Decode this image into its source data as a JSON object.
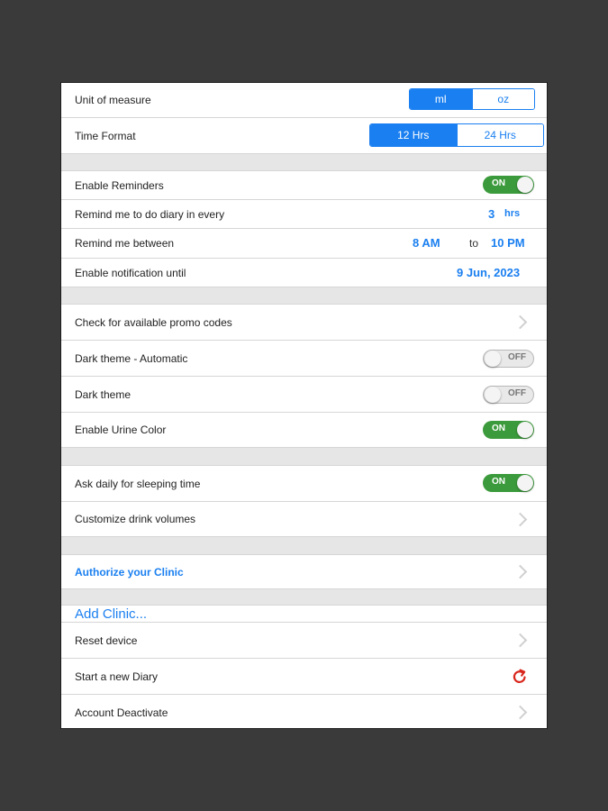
{
  "unit_of_measure": {
    "label": "Unit of measure",
    "options": [
      "ml",
      "oz"
    ],
    "selected": "ml"
  },
  "time_format": {
    "label": "Time Format",
    "options": [
      "12 Hrs",
      "24 Hrs"
    ],
    "selected": "12 Hrs"
  },
  "enable_reminders": {
    "label": "Enable Reminders",
    "state": "ON"
  },
  "remind_interval": {
    "label": "Remind me to do diary in every",
    "value": "3",
    "unit": "hrs"
  },
  "remind_between": {
    "label": "Remind me between",
    "start": "8 AM",
    "to": "to",
    "end": "10 PM"
  },
  "notification_until": {
    "label": "Enable notification until",
    "value": "9 Jun, 2023"
  },
  "promo_codes": {
    "label": "Check for available promo codes"
  },
  "dark_theme_auto": {
    "label": "Dark theme - Automatic",
    "state": "OFF"
  },
  "dark_theme": {
    "label": "Dark theme",
    "state": "OFF"
  },
  "urine_color": {
    "label": "Enable Urine Color",
    "state": "ON"
  },
  "sleeping_time": {
    "label": "Ask daily for sleeping time",
    "state": "ON"
  },
  "drink_volumes": {
    "label": "Customize drink volumes"
  },
  "authorize_clinic": {
    "label": "Authorize your Clinic"
  },
  "add_clinic": {
    "label": "Add Clinic..."
  },
  "reset_device": {
    "label": "Reset device"
  },
  "new_diary": {
    "label": "Start a new Diary",
    "icon": "refresh-icon"
  },
  "account_deactivate": {
    "label": "Account Deactivate"
  },
  "colors": {
    "accent": "#1a7ff0",
    "toggle_on": "#3b9a3b",
    "refresh": "#d9261c"
  }
}
